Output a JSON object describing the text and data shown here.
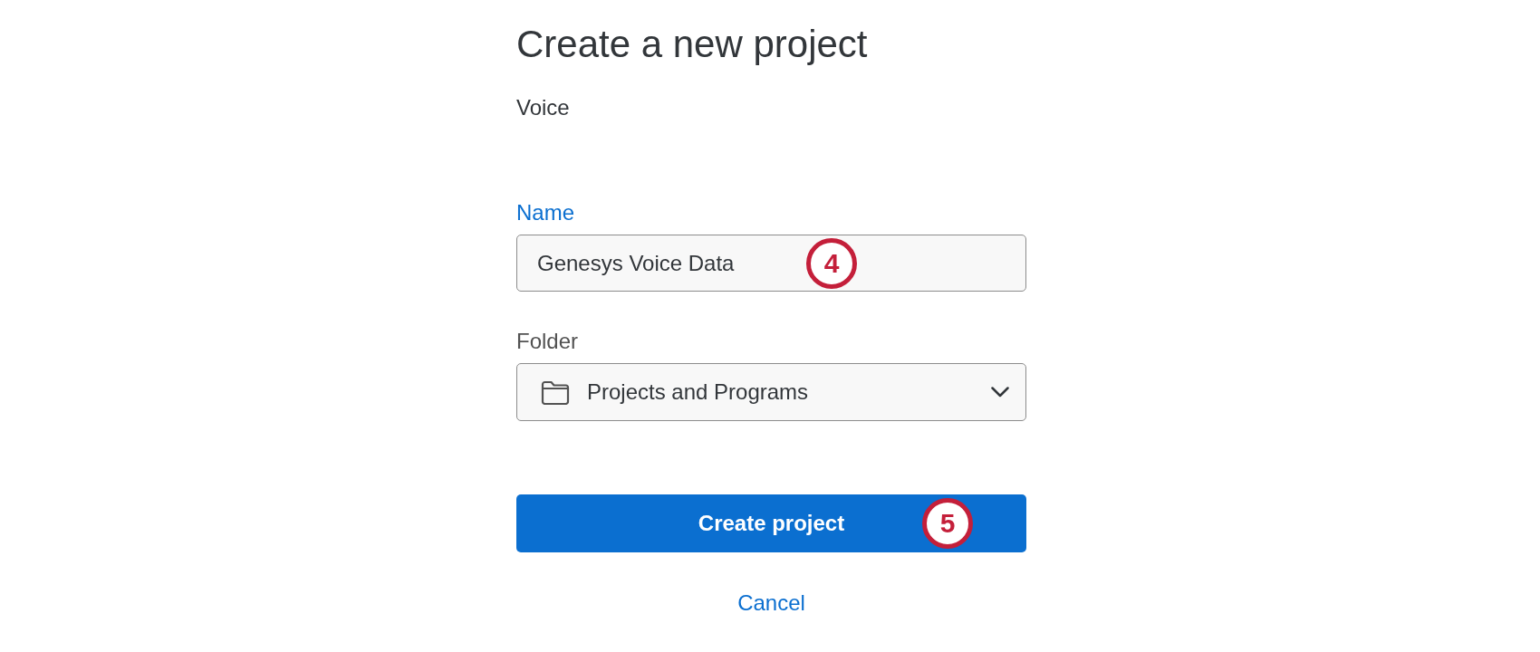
{
  "heading": "Create a new project",
  "subtitle": "Voice",
  "fields": [
    {
      "kind": "text",
      "label": "Name",
      "value": "Genesys Voice Data",
      "focused": true,
      "marker": "4"
    },
    {
      "kind": "select",
      "label": "Folder",
      "value": "Projects and Programs",
      "focused": false
    }
  ],
  "primary_button": {
    "label": "Create project",
    "marker": "5"
  },
  "cancel_link": "Cancel"
}
